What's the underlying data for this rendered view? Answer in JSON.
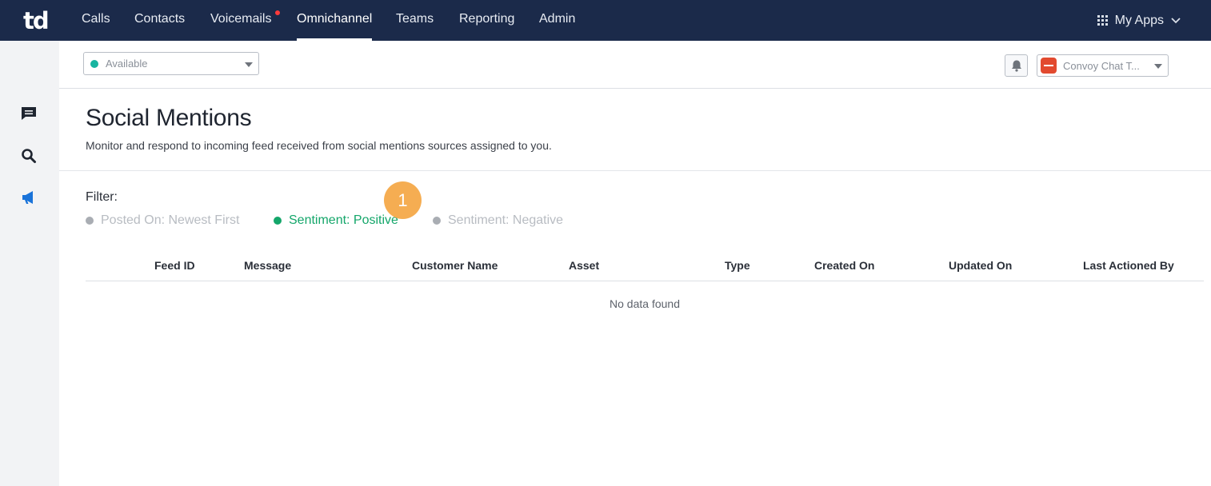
{
  "app": {
    "logo_text": "td"
  },
  "nav": {
    "items": [
      {
        "label": "Calls"
      },
      {
        "label": "Contacts"
      },
      {
        "label": "Voicemails"
      },
      {
        "label": "Omnichannel"
      },
      {
        "label": "Teams"
      },
      {
        "label": "Reporting"
      },
      {
        "label": "Admin"
      }
    ],
    "active": "Omnichannel",
    "my_apps_label": "My Apps"
  },
  "status": {
    "value": "Available",
    "color": "#17b4a0"
  },
  "inbox_select": {
    "value": "Convoy Chat T..."
  },
  "header": {
    "title": "Social Mentions",
    "subtitle": "Monitor and respond to incoming feed received from social mentions sources assigned to you."
  },
  "filter": {
    "label": "Filter:",
    "options": [
      {
        "label": "Posted On: Newest First",
        "active": false
      },
      {
        "label": "Sentiment: Positive",
        "active": true
      },
      {
        "label": "Sentiment: Negative",
        "active": false
      }
    ],
    "step_badge": "1"
  },
  "table": {
    "columns": [
      "Feed ID",
      "Message",
      "Customer Name",
      "Asset",
      "Type",
      "Created On",
      "Updated On",
      "Last Actioned By"
    ],
    "empty_message": "No data found"
  },
  "colors": {
    "topbar": "#1b2a4a",
    "active_filter": "#14a66a",
    "badge": "#f5ad52",
    "notification_dot": "#ff3b3b"
  }
}
